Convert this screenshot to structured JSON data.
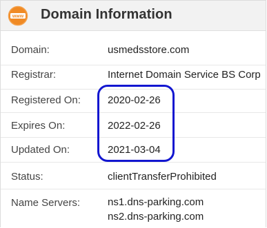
{
  "header": {
    "icon_text": "www",
    "title": "Domain Information",
    "accent_color": "#f08a24"
  },
  "rows": [
    {
      "label": "Domain:",
      "value": "usmedsstore.com"
    },
    {
      "label": "Registrar:",
      "value": "Internet Domain Service BS Corp"
    },
    {
      "label": "Registered On:",
      "value": "2020-02-26"
    },
    {
      "label": "Expires On:",
      "value": "2022-02-26"
    },
    {
      "label": "Updated On:",
      "value": "2021-03-04"
    },
    {
      "label": "Status:",
      "value": "clientTransferProhibited"
    },
    {
      "label": "Name Servers:",
      "values": [
        "ns1.dns-parking.com",
        "ns2.dns-parking.com"
      ]
    }
  ],
  "highlight_color": "#1216d0"
}
